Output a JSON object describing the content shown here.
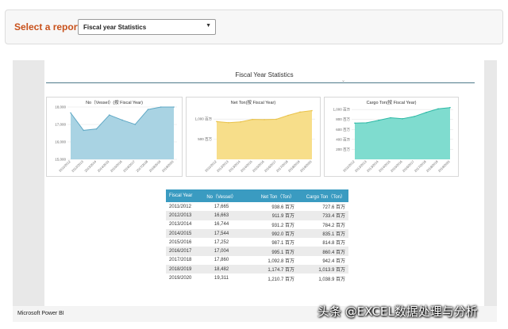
{
  "selector": {
    "label": "Select a report:",
    "value": "Fiscal year Statistics"
  },
  "report": {
    "title": "Fiscal Year Statistics"
  },
  "charts": [
    {
      "title": "No（Vessel）(按 Fiscal Year)",
      "color": "#a9d3e3",
      "stroke": "#5fa8c5",
      "ymin": 15000,
      "ymax": 18000,
      "yticks": [
        "18,000",
        "17,000",
        "16,000",
        "15,000"
      ],
      "values": [
        17665,
        16663,
        16744,
        17544,
        17252,
        17004,
        17860,
        18482,
        19311
      ]
    },
    {
      "title": "Net Ton(按 Fiscal Year)",
      "color": "#f7de8a",
      "stroke": "#e9c24a",
      "ymin": 0,
      "ymax": 1300,
      "yticks": [
        "1,000 百万",
        "500 百万"
      ],
      "ytickvals": [
        1000,
        500
      ],
      "values": [
        938.6,
        911.9,
        931.2,
        992.0,
        987.1,
        995.1,
        1092.8,
        1174.7,
        1210.7
      ]
    },
    {
      "title": "Cargo Ton(按 Fiscal Year)",
      "color": "#7fdccf",
      "stroke": "#2fb9a6",
      "ymin": 0,
      "ymax": 1050,
      "yticks": [
        "1,000 百万",
        "800 百万",
        "600 百万",
        "400 百万",
        "200 百万"
      ],
      "ytickvals": [
        1000,
        800,
        600,
        400,
        200
      ],
      "values": [
        727.6,
        733.4,
        784.2,
        835.1,
        814.8,
        860.4,
        942.4,
        1013.9,
        1038.9
      ]
    }
  ],
  "chart_data": [
    {
      "type": "area",
      "title": "No（Vessel）(按 Fiscal Year)",
      "x": [
        "2011/2012",
        "2012/2013",
        "2013/2014",
        "2014/2015",
        "2015/2016",
        "2016/2017",
        "2017/2018",
        "2018/2019",
        "2019/2020"
      ],
      "values": [
        17665,
        16663,
        16744,
        17544,
        17252,
        17004,
        17860,
        18482,
        19311
      ],
      "ylim": [
        15000,
        18000
      ]
    },
    {
      "type": "area",
      "title": "Net Ton(按 Fiscal Year)",
      "x": [
        "2011/2012",
        "2012/2013",
        "2013/2014",
        "2014/2015",
        "2015/2016",
        "2016/2017",
        "2017/2018",
        "2018/2019",
        "2019/2020"
      ],
      "values": [
        938.6,
        911.9,
        931.2,
        992.0,
        987.1,
        995.1,
        1092.8,
        1174.7,
        1210.7
      ]
    },
    {
      "type": "area",
      "title": "Cargo Ton(按 Fiscal Year)",
      "x": [
        "2011/2012",
        "2012/2013",
        "2013/2014",
        "2014/2015",
        "2015/2016",
        "2016/2017",
        "2017/2018",
        "2018/2019",
        "2019/2020"
      ],
      "values": [
        727.6,
        733.4,
        784.2,
        835.1,
        814.8,
        860.4,
        942.4,
        1013.9,
        1038.9
      ]
    }
  ],
  "categories": [
    "2011/2012",
    "2012/2013",
    "2013/2014",
    "2014/2015",
    "2015/2016",
    "2016/2017",
    "2017/2018",
    "2018/2019",
    "2019/2020"
  ],
  "table": {
    "headers": [
      "Fiscal Year",
      "No（Vessel）",
      "Net Ton（Ton）",
      "Cargo Ton（Ton）"
    ],
    "rows": [
      [
        "2011/2012",
        "17,665",
        "938.6 百万",
        "727.6 百万"
      ],
      [
        "2012/2013",
        "16,663",
        "911.9 百万",
        "733.4 百万"
      ],
      [
        "2013/2014",
        "16,744",
        "931.2 百万",
        "784.2 百万"
      ],
      [
        "2014/2015",
        "17,544",
        "992.0 百万",
        "835.1 百万"
      ],
      [
        "2015/2016",
        "17,252",
        "987.1 百万",
        "814.8 百万"
      ],
      [
        "2016/2017",
        "17,004",
        "995.1 百万",
        "860.4 百万"
      ],
      [
        "2017/2018",
        "17,860",
        "1,092.8 百万",
        "942.4 百万"
      ],
      [
        "2018/2019",
        "18,482",
        "1,174.7 百万",
        "1,013.9 百万"
      ],
      [
        "2019/2020",
        "19,311",
        "1,210.7 百万",
        "1,038.9 百万"
      ]
    ]
  },
  "footer": {
    "brand": "Microsoft Power BI"
  },
  "watermark": "头条 @EXCEL数据处理与分析"
}
